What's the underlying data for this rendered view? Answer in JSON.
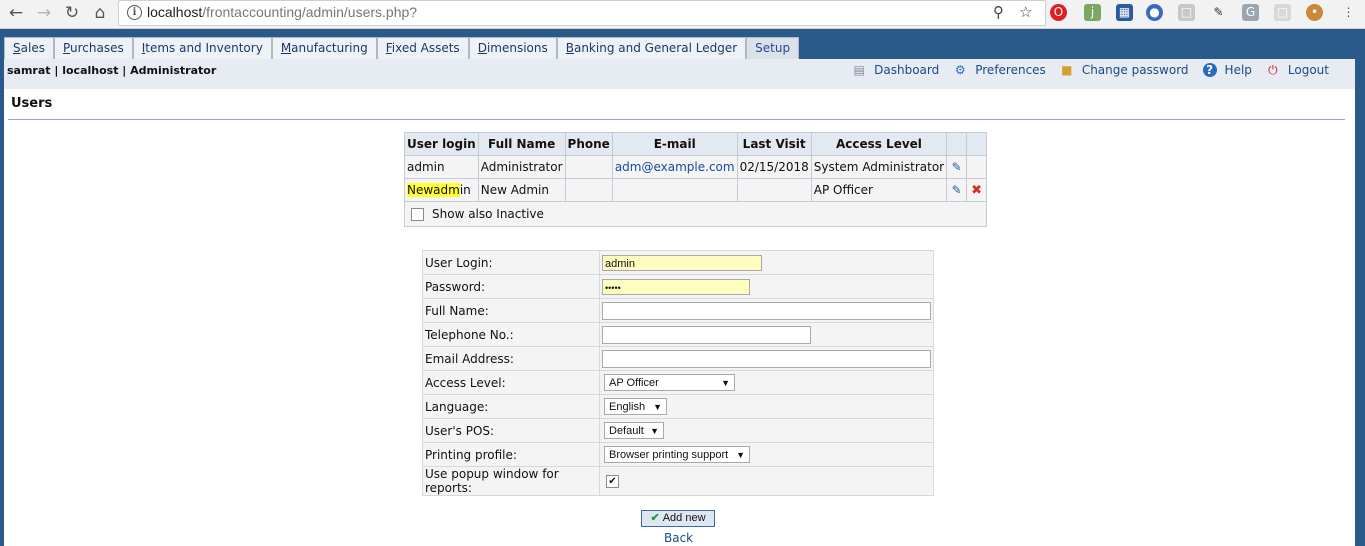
{
  "browser": {
    "url_host": "localhost",
    "url_path": "/frontaccounting/admin/users.php?"
  },
  "tabs": [
    {
      "label": "Sales",
      "ul": "S",
      "rest": "ales"
    },
    {
      "label": "Purchases",
      "ul": "P",
      "rest": "urchases"
    },
    {
      "label": "Items and Inventory",
      "ul": "I",
      "rest": "tems and Inventory"
    },
    {
      "label": "Manufacturing",
      "ul": "M",
      "rest": "anufacturing"
    },
    {
      "label": "Fixed Assets",
      "ul": "F",
      "rest": "ixed Assets"
    },
    {
      "label": "Dimensions",
      "ul": "D",
      "rest": "imensions"
    },
    {
      "label": "Banking and General Ledger",
      "ul": "B",
      "rest": "anking and General Ledger"
    },
    {
      "label": "Setup",
      "ul": "",
      "rest": "Setup"
    }
  ],
  "userbar": {
    "who": "samrat | localhost | Administrator",
    "dashboard": "Dashboard",
    "preferences": "Preferences",
    "change_password": "Change password",
    "help": "Help",
    "logout": "Logout"
  },
  "page_title": "Users",
  "users_table": {
    "headers": [
      "User login",
      "Full Name",
      "Phone",
      "E-mail",
      "Last Visit",
      "Access Level"
    ],
    "rows": [
      {
        "login": "admin",
        "full_name": "Administrator",
        "phone": "",
        "email": "adm@example.com",
        "last_visit": "02/15/2018",
        "access": "System Administrator"
      },
      {
        "login_highlight": "Newadm",
        "login_rest": "in",
        "full_name": "New Admin",
        "phone": "",
        "email": "",
        "last_visit": "",
        "access": "AP Officer"
      }
    ],
    "show_inactive": "Show also Inactive"
  },
  "form": {
    "user_login_label": "User Login:",
    "user_login_value": "admin",
    "password_label": "Password:",
    "password_value": "•••••",
    "full_name_label": "Full Name:",
    "telephone_label": "Telephone No.:",
    "email_label": "Email Address:",
    "access_level_label": "Access Level:",
    "access_level_value": "AP Officer",
    "language_label": "Language:",
    "language_value": "English",
    "pos_label": "User's POS:",
    "pos_value": "Default",
    "printing_label": "Printing profile:",
    "printing_value": "Browser printing support",
    "popup_label": "Use popup window for reports:",
    "popup_checked": "✔"
  },
  "add_new": "Add new",
  "back": "Back"
}
